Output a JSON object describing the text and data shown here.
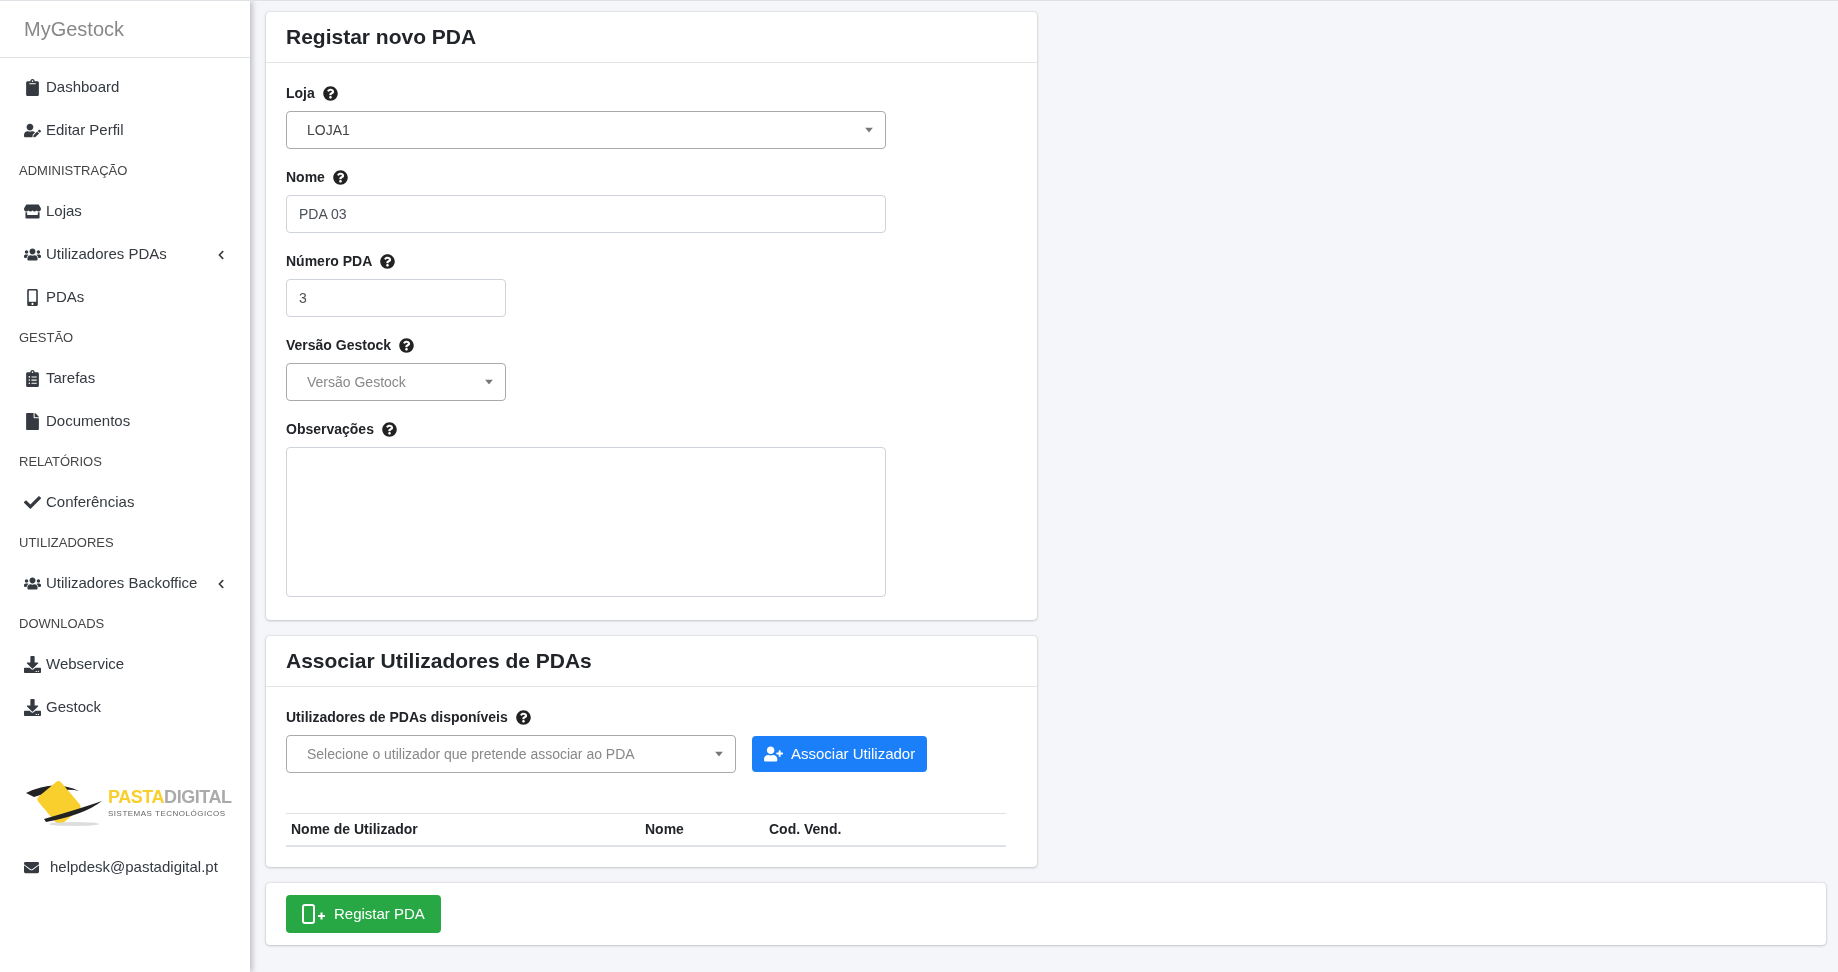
{
  "sidebar": {
    "brand": "MyGestock",
    "items": [
      {
        "kind": "link",
        "label": "Dashboard"
      },
      {
        "kind": "link",
        "label": "Editar Perfil"
      },
      {
        "kind": "header",
        "label": "ADMINISTRAÇÃO"
      },
      {
        "kind": "link",
        "label": "Lojas"
      },
      {
        "kind": "link",
        "label": "Utilizadores PDAs",
        "expanded": false
      },
      {
        "kind": "link",
        "label": "PDAs"
      },
      {
        "kind": "header",
        "label": "GESTÃO"
      },
      {
        "kind": "link",
        "label": "Tarefas"
      },
      {
        "kind": "link",
        "label": "Documentos"
      },
      {
        "kind": "header",
        "label": "RELATÓRIOS"
      },
      {
        "kind": "link",
        "label": "Conferências"
      },
      {
        "kind": "header",
        "label": "UTILIZADORES"
      },
      {
        "kind": "link",
        "label": "Utilizadores Backoffice",
        "expanded": false
      },
      {
        "kind": "header",
        "label": "DOWNLOADS"
      },
      {
        "kind": "link",
        "label": "Webservice"
      },
      {
        "kind": "link",
        "label": "Gestock"
      }
    ],
    "logo": {
      "part1": "PASTA",
      "part2": "DIGITAL",
      "tagline": "SISTEMAS TECNOLÓGICOS"
    },
    "email": "helpdesk@pastadigital.pt"
  },
  "register_card": {
    "title": "Registar novo PDA",
    "fields": [
      {
        "label": "Loja",
        "kind": "select",
        "value": "LOJA1"
      },
      {
        "label": "Nome",
        "kind": "input",
        "value": "PDA 03"
      },
      {
        "label": "Número PDA",
        "kind": "input",
        "value": "3"
      },
      {
        "label": "Versão Gestock",
        "kind": "select",
        "placeholder": "Versão Gestock"
      },
      {
        "label": "Observações",
        "kind": "textarea"
      }
    ]
  },
  "associate_card": {
    "title": "Associar Utilizadores de PDAs",
    "field_label": "Utilizadores de PDAs disponíveis",
    "select_placeholder": "Selecione o utilizador que pretende associar ao PDA",
    "button": "Associar Utilizador",
    "table": {
      "columns": [
        "Nome de Utilizador",
        "Nome",
        "Cod. Vend."
      ]
    }
  },
  "submit_button": "Registar PDA"
}
